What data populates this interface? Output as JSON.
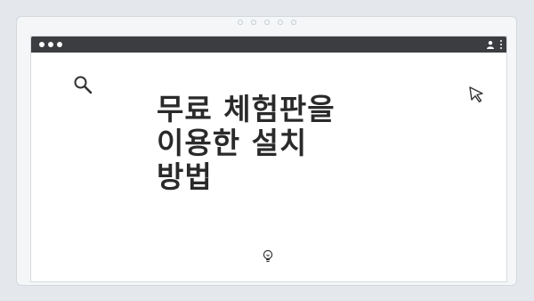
{
  "page": {
    "title_lines": [
      "무료 체험판을",
      "이용한 설치",
      "방법"
    ]
  },
  "icons": {
    "search": "search-icon",
    "cursor": "cursor-icon",
    "lightbulb": "lightbulb-icon",
    "user": "user-icon",
    "menu": "more-vertical-icon"
  },
  "colors": {
    "titlebar": "#3b3d40",
    "background": "#e4e8ed",
    "title_text": "#2a2a2a"
  }
}
